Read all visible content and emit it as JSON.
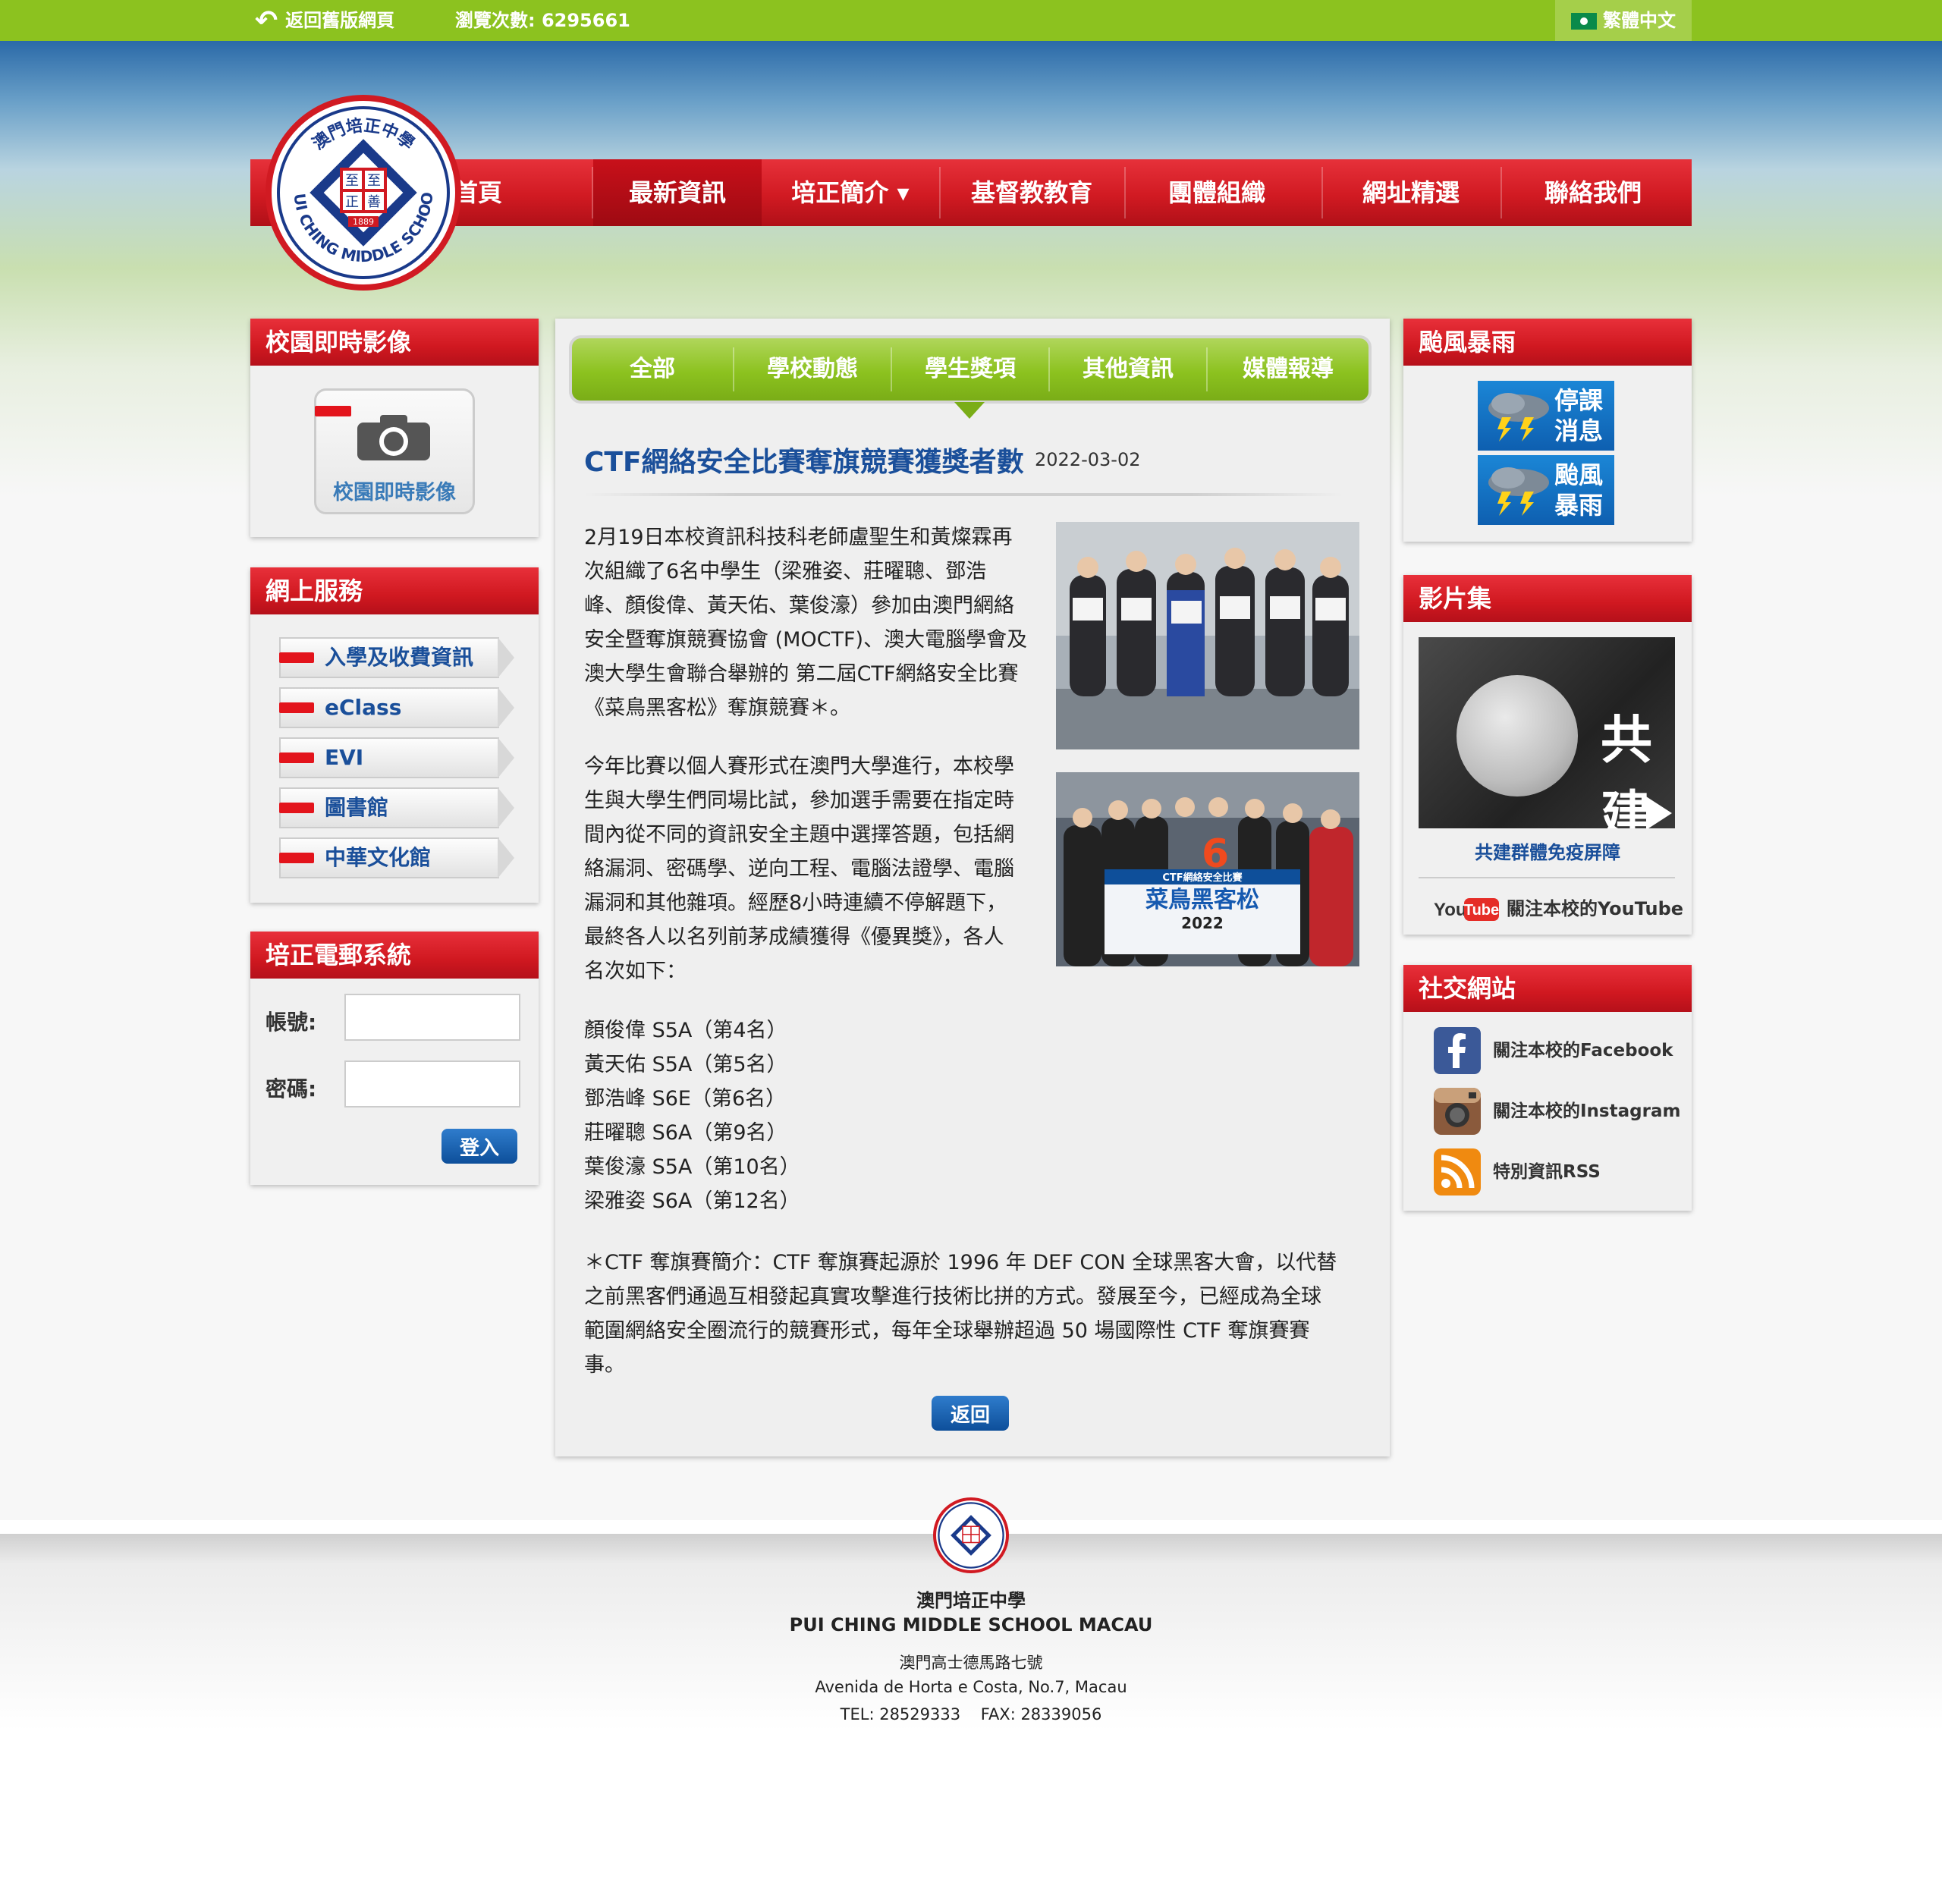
{
  "topbar": {
    "back_label": "返回舊版網頁",
    "visit_count": "瀏覽次數: 6295661",
    "language": "繁體中文"
  },
  "logo": {
    "top_text": "澳門培正中學",
    "motto": [
      "至",
      "至",
      "正",
      "善"
    ],
    "year": "1889",
    "en_text": "PUI CHING MIDDLE SCHOOL"
  },
  "nav": {
    "items": [
      "首頁",
      "最新資訊",
      "培正簡介 ▾",
      "基督教教育",
      "團體組織",
      "網址精選",
      "聯絡我們"
    ],
    "active": "最新資訊"
  },
  "left": {
    "campus": {
      "title": "校園即時影像",
      "button_label": "校園即時影像",
      "icon": "camera-icon"
    },
    "online": {
      "title": "網上服務",
      "items": [
        "入學及收費資訊",
        "eClass",
        "EVI",
        "圖書館",
        "中華文化館"
      ]
    },
    "mail": {
      "title": "培正電郵系統",
      "account_label": "帳號:",
      "account_value": "",
      "password_label": "密碼:",
      "password_value": "",
      "login_label": "登入"
    }
  },
  "tabs": {
    "items": [
      "全部",
      "學校動態",
      "學生獎項",
      "其他資訊",
      "媒體報導"
    ],
    "active": "學生獎項"
  },
  "article": {
    "title": "CTF網絡安全比賽奪旗競賽獲獎者數",
    "date": "2022-03-02",
    "para1": [
      "2月19日本校資訊科技科老師盧聖生和黃燦霖再",
      "次組織了6名中學生（梁雅姿、莊曜聰、鄧浩",
      "峰、顏俊偉、黃天佑、葉俊濠）參加由澳門網絡",
      "安全暨奪旗競賽協會 (MOCTF)、澳大電腦學會及",
      "澳大學生會聯合舉辦的 第二屆CTF網絡安全比賽",
      "《菜鳥黑客松》奪旗競賽＊。"
    ],
    "para2": [
      "今年比賽以個人賽形式在澳門大學進行，本校學",
      "生與大學生們同場比試，參加選手需要在指定時",
      "間內從不同的資訊安全主題中選擇答題，包括網",
      "絡漏洞、密碼學、逆向工程、電腦法證學、電腦",
      "漏洞和其他雜項。經歷8小時連續不停解題下，",
      "最終各人以名列前茅成績獲得《優異獎》，各人",
      "名次如下："
    ],
    "winners": [
      "顏俊偉 S5A（第4名）",
      "黃天佑 S5A（第5名）",
      "鄧浩峰 S6E（第6名）",
      "莊曜聰 S6A（第9名）",
      "葉俊濠 S5A（第10名）",
      "梁雅姿 S6A（第12名）"
    ],
    "note": [
      "＊CTF 奪旗賽簡介：CTF 奪旗賽起源於 1996 年 DEF CON 全球黑客大會，以代替",
      "之前黑客們通過互相發起真實攻擊進行技術比拼的方式。發展至今，已經成為全球",
      "範圍網絡安全圈流行的競賽形式，每年全球舉辦超過 50 場國際性 CTF 奪旗賽賽",
      "事。"
    ],
    "photo2_number": "6",
    "photo2_banner": [
      "CTF網絡安全比賽",
      "菜鳥黑客松",
      "2022"
    ],
    "back_label": "返回"
  },
  "right": {
    "typhoon": {
      "title": "颱風暴雨",
      "buttons": [
        "停課消息",
        "颱風暴雨"
      ]
    },
    "video": {
      "title": "影片集",
      "thumb_text": "共建",
      "caption": "共建群體免疫屏障",
      "youtube_label": "關注本校的YouTube",
      "youtube_logo": [
        "You",
        "Tube"
      ]
    },
    "social": {
      "title": "社交網站",
      "items": [
        {
          "label": "關注本校的Facebook",
          "icon": "facebook-icon",
          "color": "#3b5998"
        },
        {
          "label": "關注本校的Instagram",
          "icon": "instagram-icon",
          "color": "#8a5a3c"
        },
        {
          "label": "特別資訊RSS",
          "icon": "rss-icon",
          "color": "#f08a10"
        }
      ]
    }
  },
  "footer": {
    "name_zh": "澳門培正中學",
    "name_en": "PUI CHING MIDDLE SCHOOL MACAU",
    "address_zh": "澳門高士德馬路七號",
    "address_en": "Avenida de Horta e Costa, No.7, Macau",
    "contact": "TEL: 28529333    FAX: 28339056"
  },
  "colors": {
    "brand_red": "#d11a22",
    "brand_green": "#8cc21f",
    "link_blue": "#1a4f9a"
  }
}
